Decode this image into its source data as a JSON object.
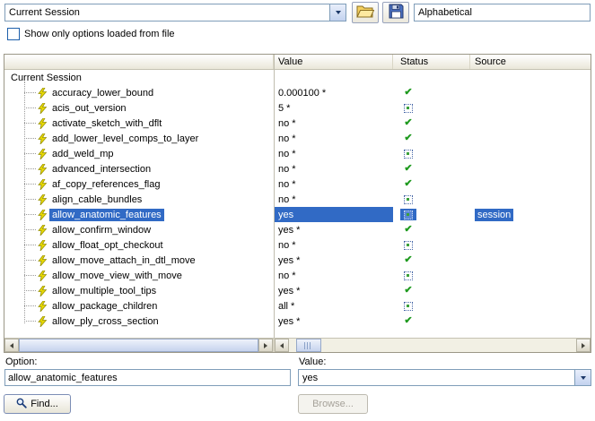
{
  "colors": {
    "selection": "#316ac5",
    "selection_text": "#ffffff",
    "status_check_green": "#1f9a1f",
    "status_square_blue": "#4868a8",
    "lightning_yellow": "#e8d900"
  },
  "toolbar": {
    "session_combo_value": "Current Session",
    "sort_combo_value": "Alphabetical",
    "open_button_icon": "open-folder-icon",
    "save_button_icon": "save-icon"
  },
  "filter": {
    "checkbox_label": "Show only options loaded from file",
    "checked": false
  },
  "table": {
    "tree_root": "Current Session",
    "headers": {
      "value": "Value",
      "status": "Status",
      "source": "Source"
    },
    "rows": [
      {
        "name": "accuracy_lower_bound",
        "value": "0.000100 *",
        "status": "check",
        "source": "",
        "selected": false
      },
      {
        "name": "acis_out_version",
        "value": "5 *",
        "status": "square",
        "source": "",
        "selected": false
      },
      {
        "name": "activate_sketch_with_dflt",
        "value": "no *",
        "status": "check",
        "source": "",
        "selected": false
      },
      {
        "name": "add_lower_level_comps_to_layer",
        "value": "no *",
        "status": "check",
        "source": "",
        "selected": false
      },
      {
        "name": "add_weld_mp",
        "value": "no *",
        "status": "square",
        "source": "",
        "selected": false
      },
      {
        "name": "advanced_intersection",
        "value": "no *",
        "status": "check",
        "source": "",
        "selected": false
      },
      {
        "name": "af_copy_references_flag",
        "value": "no *",
        "status": "check",
        "source": "",
        "selected": false
      },
      {
        "name": "align_cable_bundles",
        "value": "no *",
        "status": "square",
        "source": "",
        "selected": false
      },
      {
        "name": "allow_anatomic_features",
        "value": "yes",
        "status": "square",
        "source": "session",
        "selected": true
      },
      {
        "name": "allow_confirm_window",
        "value": "yes *",
        "status": "check",
        "source": "",
        "selected": false
      },
      {
        "name": "allow_float_opt_checkout",
        "value": "no *",
        "status": "square",
        "source": "",
        "selected": false
      },
      {
        "name": "allow_move_attach_in_dtl_move",
        "value": "yes *",
        "status": "check",
        "source": "",
        "selected": false
      },
      {
        "name": "allow_move_view_with_move",
        "value": "no *",
        "status": "square",
        "source": "",
        "selected": false
      },
      {
        "name": "allow_multiple_tool_tips",
        "value": "yes *",
        "status": "check",
        "source": "",
        "selected": false
      },
      {
        "name": "allow_package_children",
        "value": "all *",
        "status": "square",
        "source": "",
        "selected": false
      },
      {
        "name": "allow_ply_cross_section",
        "value": "yes *",
        "status": "check",
        "source": "",
        "selected": false
      }
    ]
  },
  "option_editor": {
    "option_label": "Option:",
    "option_value": "allow_anatomic_features",
    "value_label": "Value:",
    "value_value": "yes"
  },
  "actions": {
    "find_label": "Find...",
    "browse_label": "Browse..."
  }
}
